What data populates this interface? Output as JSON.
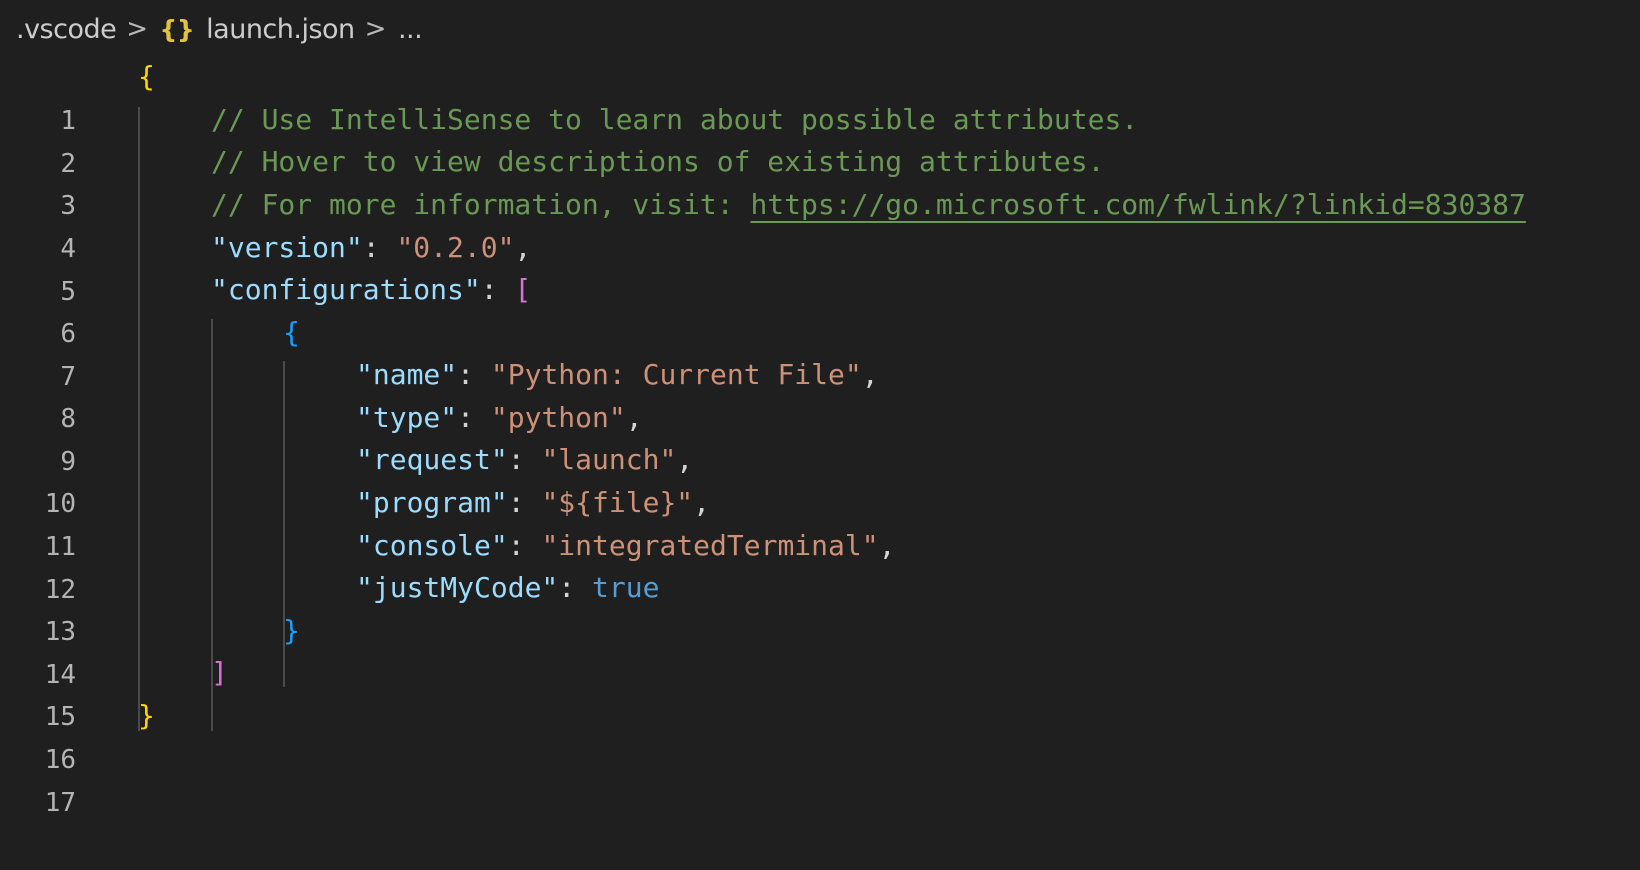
{
  "breadcrumb": {
    "folder": ".vscode",
    "separator": ">",
    "file_icon": "{}",
    "file": "launch.json",
    "more": "..."
  },
  "colors": {
    "background": "#1f1f1f",
    "comment": "#6a9955",
    "key": "#9cdcfe",
    "string": "#ce9178",
    "boolean": "#569cd6",
    "brace_level1": "#ffd700",
    "bracket_level2": "#da70d6",
    "brace_level3": "#179fff"
  },
  "editor": {
    "line_numbers": [
      "1",
      "2",
      "3",
      "4",
      "5",
      "6",
      "7",
      "8",
      "9",
      "10",
      "11",
      "12",
      "13",
      "14",
      "15",
      "16",
      "17"
    ],
    "lines": {
      "l1": {
        "brace": "{"
      },
      "l2": {
        "comment": "// Use IntelliSense to learn about possible attributes."
      },
      "l3": {
        "comment": "// Hover to view descriptions of existing attributes."
      },
      "l4": {
        "comment": "// For more information, visit: ",
        "link": "https://go.microsoft.com/fwlink/?linkid=830387"
      },
      "l5": {
        "key": "\"version\"",
        "colon": ": ",
        "value": "\"0.2.0\"",
        "comma": ","
      },
      "l6": {
        "key": "\"configurations\"",
        "colon": ": ",
        "bracket": "["
      },
      "l7": {
        "brace": "{"
      },
      "l8": {
        "key": "\"name\"",
        "colon": ": ",
        "value": "\"Python: Current File\"",
        "comma": ","
      },
      "l9": {
        "key": "\"type\"",
        "colon": ": ",
        "value": "\"python\"",
        "comma": ","
      },
      "l10": {
        "key": "\"request\"",
        "colon": ": ",
        "value": "\"launch\"",
        "comma": ","
      },
      "l11": {
        "key": "\"program\"",
        "colon": ": ",
        "value": "\"${file}\"",
        "comma": ","
      },
      "l12": {
        "key": "\"console\"",
        "colon": ": ",
        "value": "\"integratedTerminal\"",
        "comma": ","
      },
      "l13": {
        "key": "\"justMyCode\"",
        "colon": ": ",
        "value": "true"
      },
      "l14": {
        "brace": "}"
      },
      "l15": {
        "bracket": "]"
      },
      "l16": {
        "brace": "}"
      }
    }
  }
}
